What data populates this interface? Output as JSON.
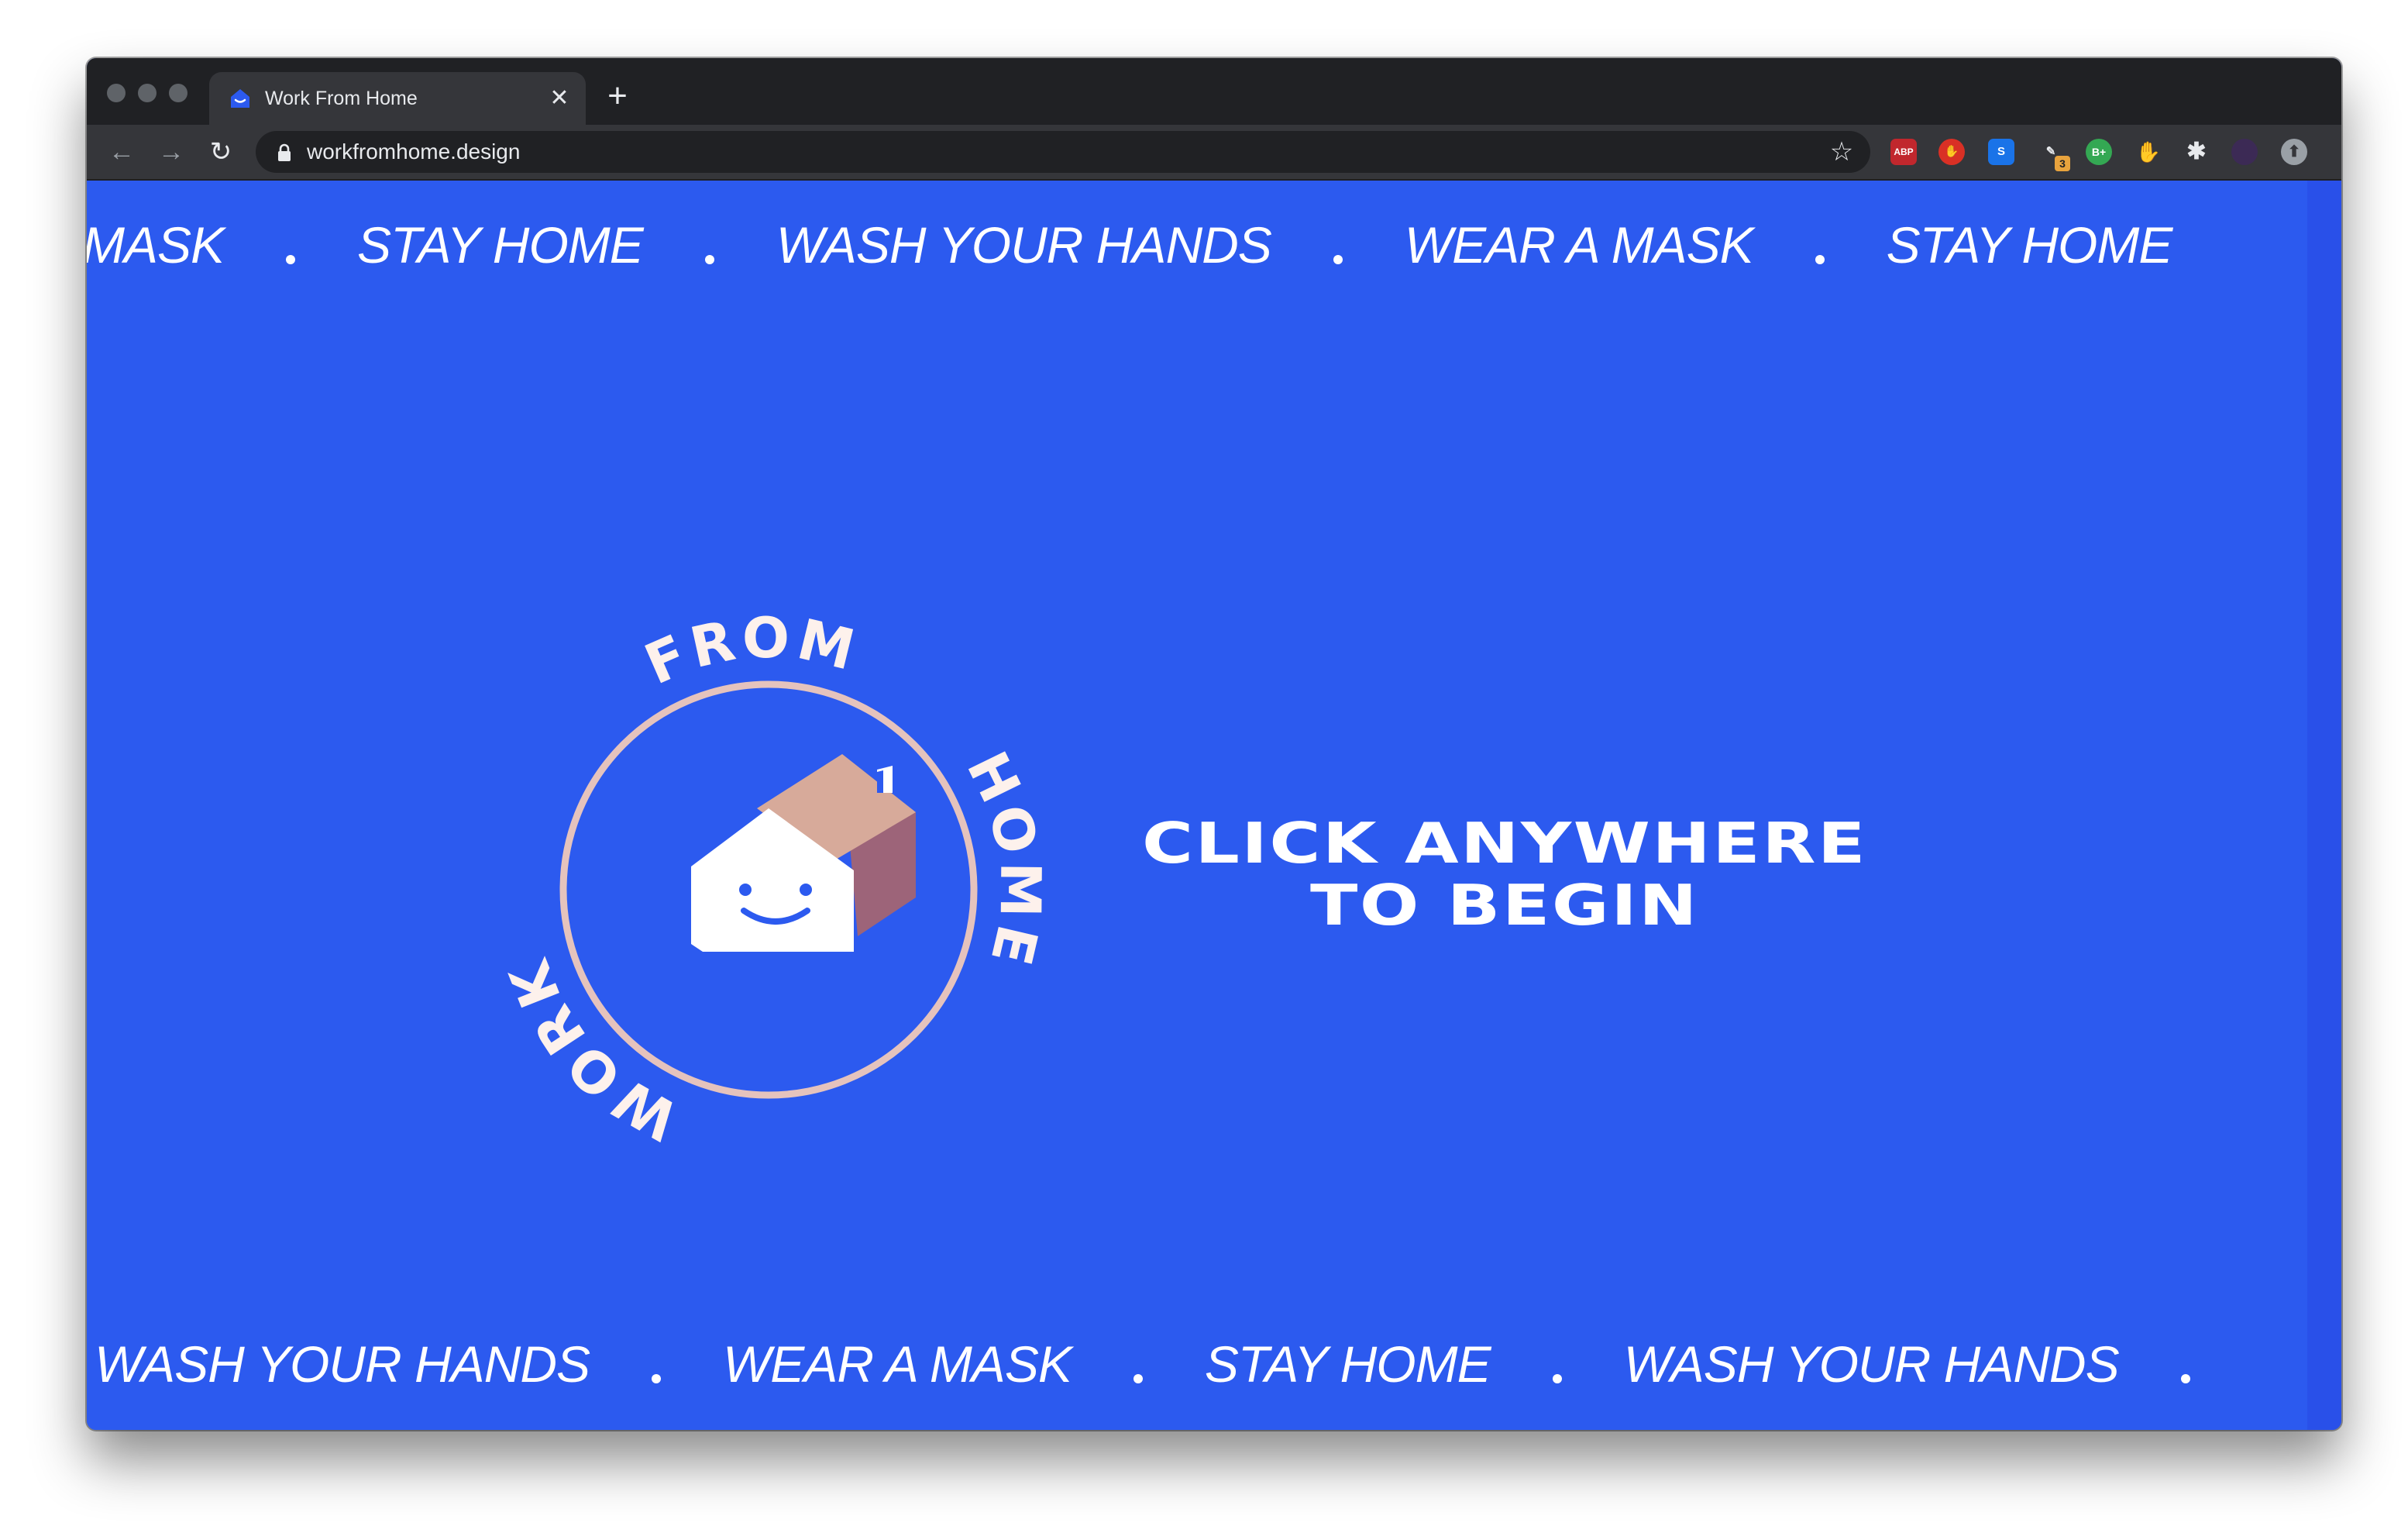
{
  "browser": {
    "tab_title": "Work From Home",
    "tab_close": "✕",
    "new_tab": "+",
    "url": "workfromhome.design",
    "extensions": [
      "ABP",
      "B+"
    ],
    "extension_badge": "3"
  },
  "marquee_top": [
    "MASK",
    "STAY HOME",
    "WASH YOUR HANDS",
    "WEAR A MASK",
    "STAY HOME"
  ],
  "marquee_bottom": [
    "WASH YOUR HANDS",
    "WEAR A MASK",
    "STAY HOME",
    "WASH YOUR HANDS"
  ],
  "logo": {
    "words": [
      "FROM",
      "HOME",
      "WORK"
    ]
  },
  "cta": {
    "line1": "CLICK ANYWHERE",
    "line2": "TO BEGIN"
  },
  "colors": {
    "background": "#2c5aef",
    "ring": "#e5c3bd",
    "house_roof": "#d7aa9a",
    "house_side": "#9d6479",
    "text": "#ffffff"
  }
}
